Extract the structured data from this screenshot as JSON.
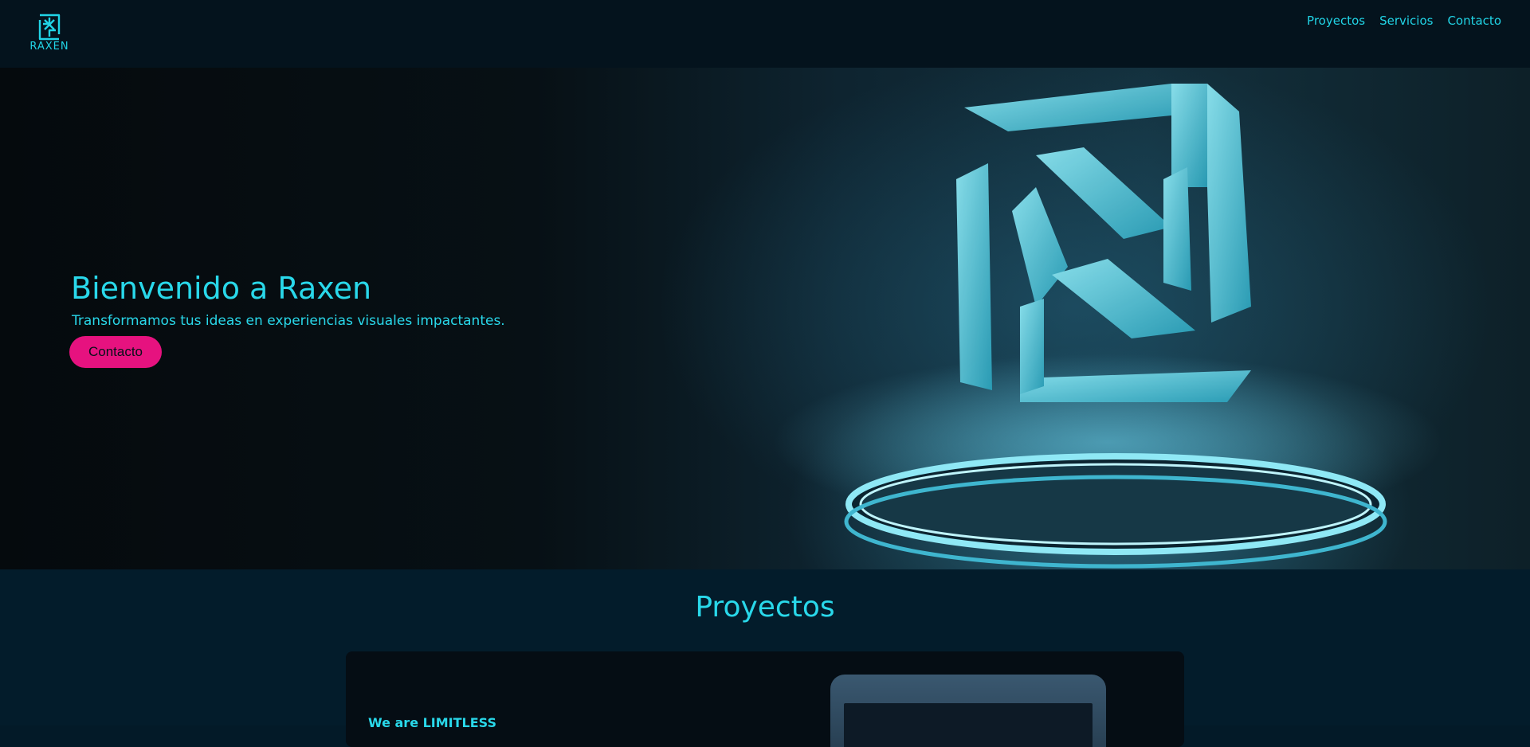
{
  "brand": {
    "name": "RAXEN",
    "logo_icon": "raxen-logo-icon"
  },
  "nav": {
    "items": [
      "Proyectos",
      "Servicios",
      "Contacto"
    ]
  },
  "hero": {
    "title": "Bienvenido a Raxen",
    "subtitle": "Transformamos tus ideas en experiencias visuales impactantes.",
    "button_label": "Contacto",
    "art_icon": "raxen-3d-logo-on-pedestal"
  },
  "projects": {
    "title": "Proyectos",
    "cards": [
      {
        "name": "We are LIMITLESS",
        "preview_icon": "app-preview-image"
      }
    ]
  },
  "colors": {
    "accent": "#29d8ea",
    "button": "#e6127f",
    "header_bg": "#04131d",
    "section_bg": "#031c2b"
  }
}
